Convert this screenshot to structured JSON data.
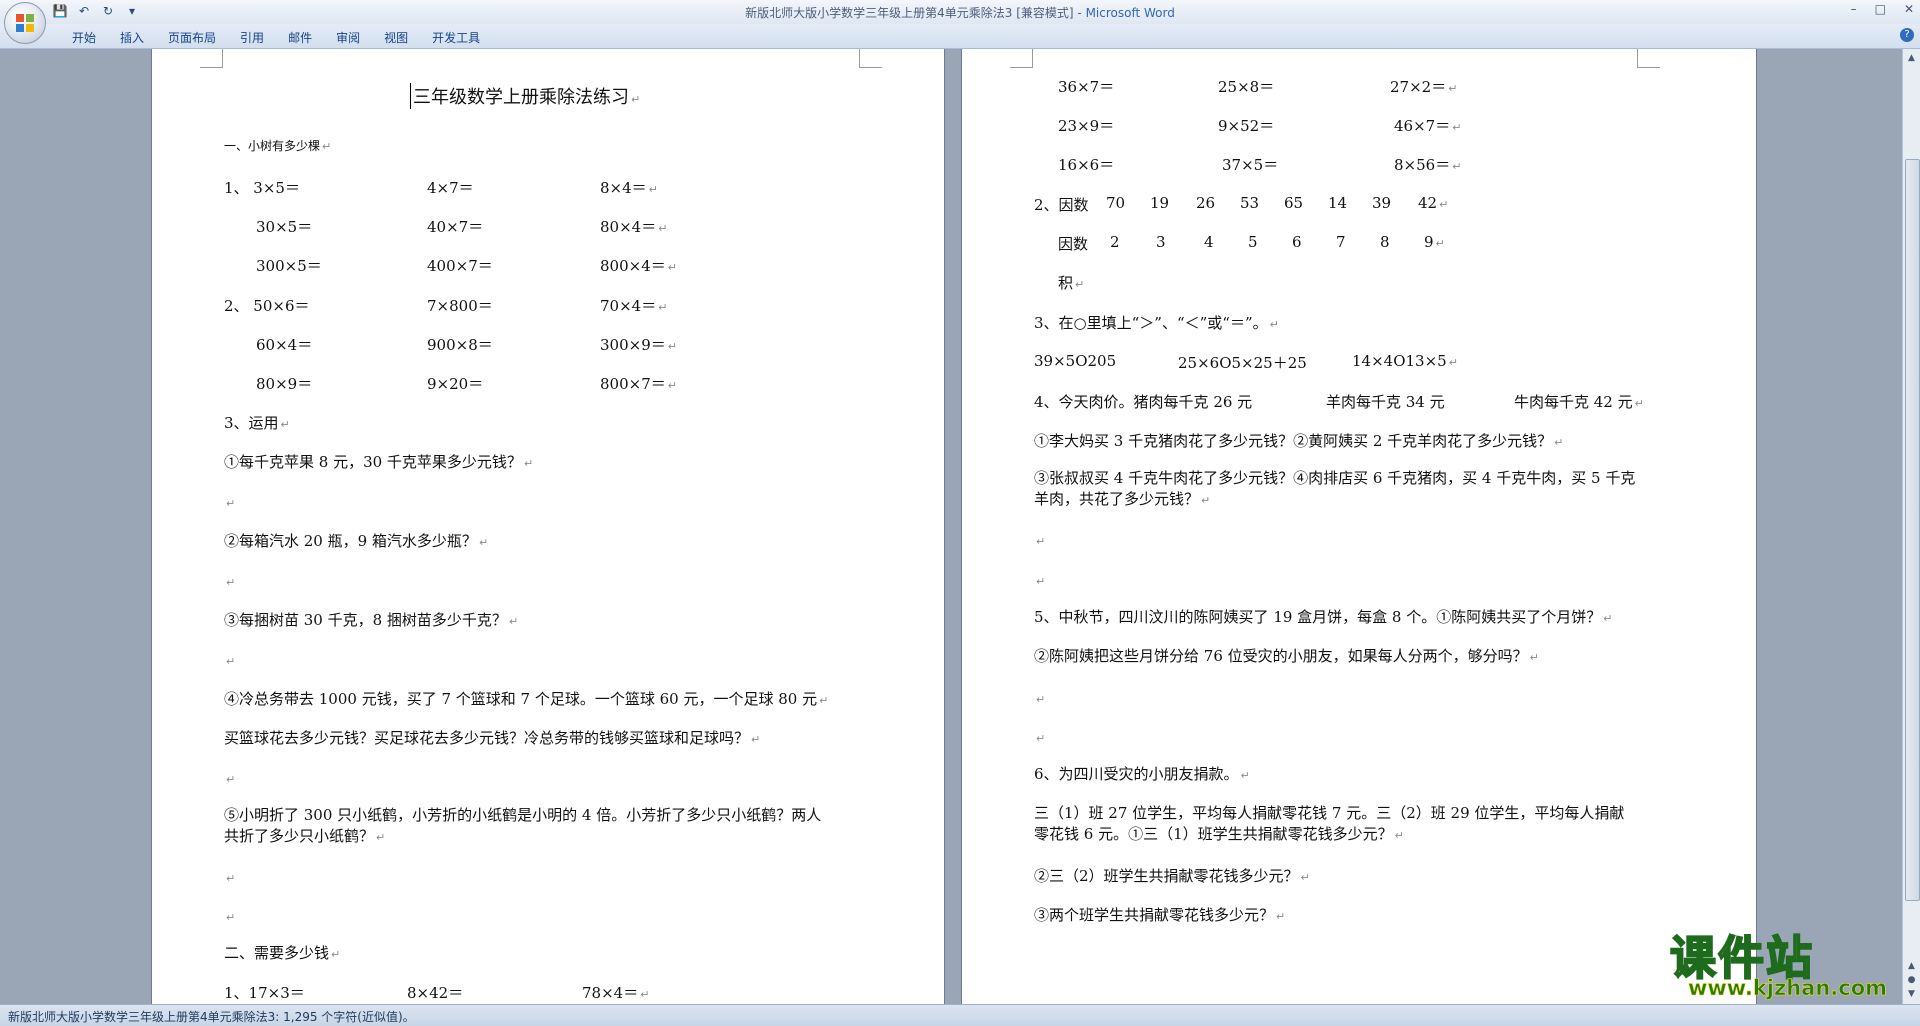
{
  "window": {
    "title_doc": "新版北师大版小学数学三年级上册第4单元乘除法3 [兼容模式] - ",
    "title_app": "Microsoft Word"
  },
  "ribbon": {
    "tabs": [
      "开始",
      "插入",
      "页面布局",
      "引用",
      "邮件",
      "审阅",
      "视图",
      "开发工具"
    ]
  },
  "page1": {
    "title": "三年级数学上册乘除法练习",
    "lines": [
      "一、小树有多少棵",
      "1、  3×5＝",
      "4×7＝",
      "8×4＝",
      "30×5＝",
      "40×7＝",
      "80×4＝",
      "300×5＝",
      "400×7＝",
      "800×4＝",
      "2、  50×6＝",
      "7×800＝",
      "70×4＝",
      "60×4＝",
      "900×8＝",
      "300×9＝",
      "80×9＝",
      "9×20＝",
      "800×7＝",
      "3、运用",
      "①每千克苹果 8 元，30 千克苹果多少元钱？",
      "②每箱汽水 20 瓶，9 箱汽水多少瓶？",
      "③每捆树苗 30 千克，8 捆树苗多少千克？",
      "④冷总务带去 1000 元钱，买了 7 个篮球和 7 个足球。一个篮球 60 元，一个足球 80 元",
      "买篮球花去多少元钱？买足球花去多少元钱？冷总务带的钱够买篮球和足球吗？",
      "⑤小明折了 300 只小纸鹤，小芳折的小纸鹤是小明的 4 倍。小芳折了多少只小纸鹤？两人共折了多少只小纸鹤？",
      "二、需要多少钱",
      "1、17×3＝",
      "8×42＝",
      "78×4＝"
    ]
  },
  "page2": {
    "lines": [
      "36×7＝",
      "25×8＝",
      "27×2＝",
      "23×9＝",
      "9×52＝",
      "46×7＝",
      "16×6＝",
      "37×5＝",
      "8×56＝",
      "2、因数",
      "因数",
      "积",
      "3、在○里填上“＞”、“＜”或“＝”。",
      "39×5O205",
      "25×6O5×25＋25",
      "14×4O13×5",
      "4、今天肉价。猪肉每千克 26 元",
      "羊肉每千克 34 元",
      "牛肉每千克 42 元",
      "①李大妈买 3 千克猪肉花了多少元钱？②黄阿姨买 2 千克羊肉花了多少元钱？",
      "③张叔叔买 4 千克牛肉花了多少元钱？④肉排店买 6 千克猪肉，买 4 千克牛肉，买 5 千克羊肉，共花了多少元钱？",
      "5、中秋节，四川汶川的陈阿姨买了 19 盒月饼，每盒 8 个。①陈阿姨共买了个月饼？",
      "②陈阿姨把这些月饼分给 76 位受灾的小朋友，如果每人分两个，够分吗？",
      "6、为四川受灾的小朋友捐款。",
      "三（1）班 27 位学生，平均每人捐献零花钱 7 元。三（2）班 29 位学生，平均每人捐献零花钱 6 元。①三（1）班学生共捐献零花钱多少元？",
      "②三（2）班学生共捐献零花钱多少元？",
      "③两个班学生共捐献零花钱多少元？"
    ],
    "factors_row1": [
      "70",
      "19",
      "26",
      "53",
      "65",
      "14",
      "39",
      "42"
    ],
    "factors_row2": [
      "2",
      "3",
      "4",
      "5",
      "6",
      "7",
      "8",
      "9"
    ]
  },
  "status": {
    "text": "新版北师大版小学数学三年级上册第4单元乘除法3: 1,295 个字符(近似值)。"
  },
  "watermark": {
    "cn": "课件站",
    "url": "www.kjzhan.com"
  }
}
